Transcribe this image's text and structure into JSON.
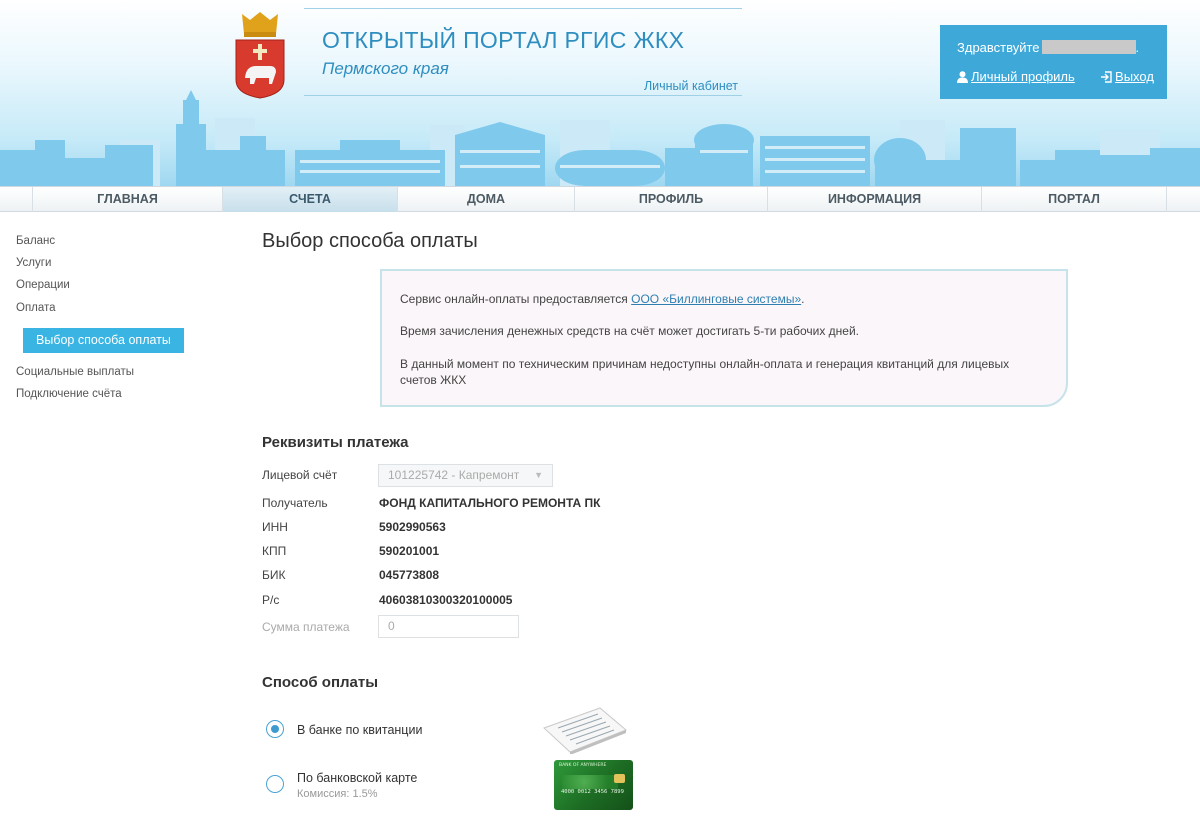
{
  "header": {
    "portal_title": "ОТКРЫТЫЙ ПОРТАЛ РГИС ЖКХ",
    "portal_subtitle": "Пермского края",
    "cabinet_link": "Личный кабинет",
    "greeting": "Здравствуйте",
    "greeting_suffix": ".",
    "profile_link": "Личный профиль",
    "logout_link": "Выход"
  },
  "nav": {
    "items": [
      {
        "label": "ГЛАВНАЯ"
      },
      {
        "label": "СЧЕТА"
      },
      {
        "label": "ДОМА"
      },
      {
        "label": "ПРОФИЛЬ"
      },
      {
        "label": "ИНФОРМАЦИЯ"
      },
      {
        "label": "ПОРТАЛ"
      }
    ],
    "active": "СЧЕТА"
  },
  "sidebar": {
    "items": [
      {
        "label": "Баланс"
      },
      {
        "label": "Услуги"
      },
      {
        "label": "Операции"
      },
      {
        "label": "Оплата"
      },
      {
        "label": "Выбор способа оплаты"
      },
      {
        "label": "Социальные выплаты"
      },
      {
        "label": "Подключение счёта"
      }
    ]
  },
  "main": {
    "page_title": "Выбор способа оплаты",
    "notice": {
      "line1_before": "Сервис онлайн-оплаты предоставляется ",
      "line1_link": "ООО «Биллинговые системы»",
      "line1_after": ".",
      "line2": "Время зачисления денежных средств на счёт может достигать 5-ти рабочих дней.",
      "line3": "В данный момент по техническим причинам недоступны онлайн-оплата и генерация квитанций для лицевых счетов ЖКХ"
    },
    "details": {
      "heading": "Реквизиты платежа",
      "account_label": "Лицевой счёт",
      "account_value": "101225742 - Капремонт",
      "recipient_label": "Получатель",
      "recipient_value": "ФОНД КАПИТАЛЬНОГО РЕМОНТА ПК",
      "inn_label": "ИНН",
      "inn_value": "5902990563",
      "kpp_label": "КПП",
      "kpp_value": "590201001",
      "bik_label": "БИК",
      "bik_value": "045773808",
      "rs_label": "Р/с",
      "rs_value": "40603810300320100005",
      "amount_label": "Сумма платежа",
      "amount_value": "0"
    },
    "payment": {
      "heading": "Способ оплаты",
      "options": [
        {
          "label": "В банке по квитанции",
          "selected": true
        },
        {
          "label": "По банковской карте",
          "sub": "Комиссия: 1.5%",
          "selected": false
        }
      ],
      "card_image_text": "BANK OF ANYWHERE",
      "card_number": "4000 0012 3456 7899"
    }
  },
  "colors": {
    "accent": "#3ab4e2",
    "link": "#2f8ec0",
    "user_box": "#3ea9d9"
  }
}
